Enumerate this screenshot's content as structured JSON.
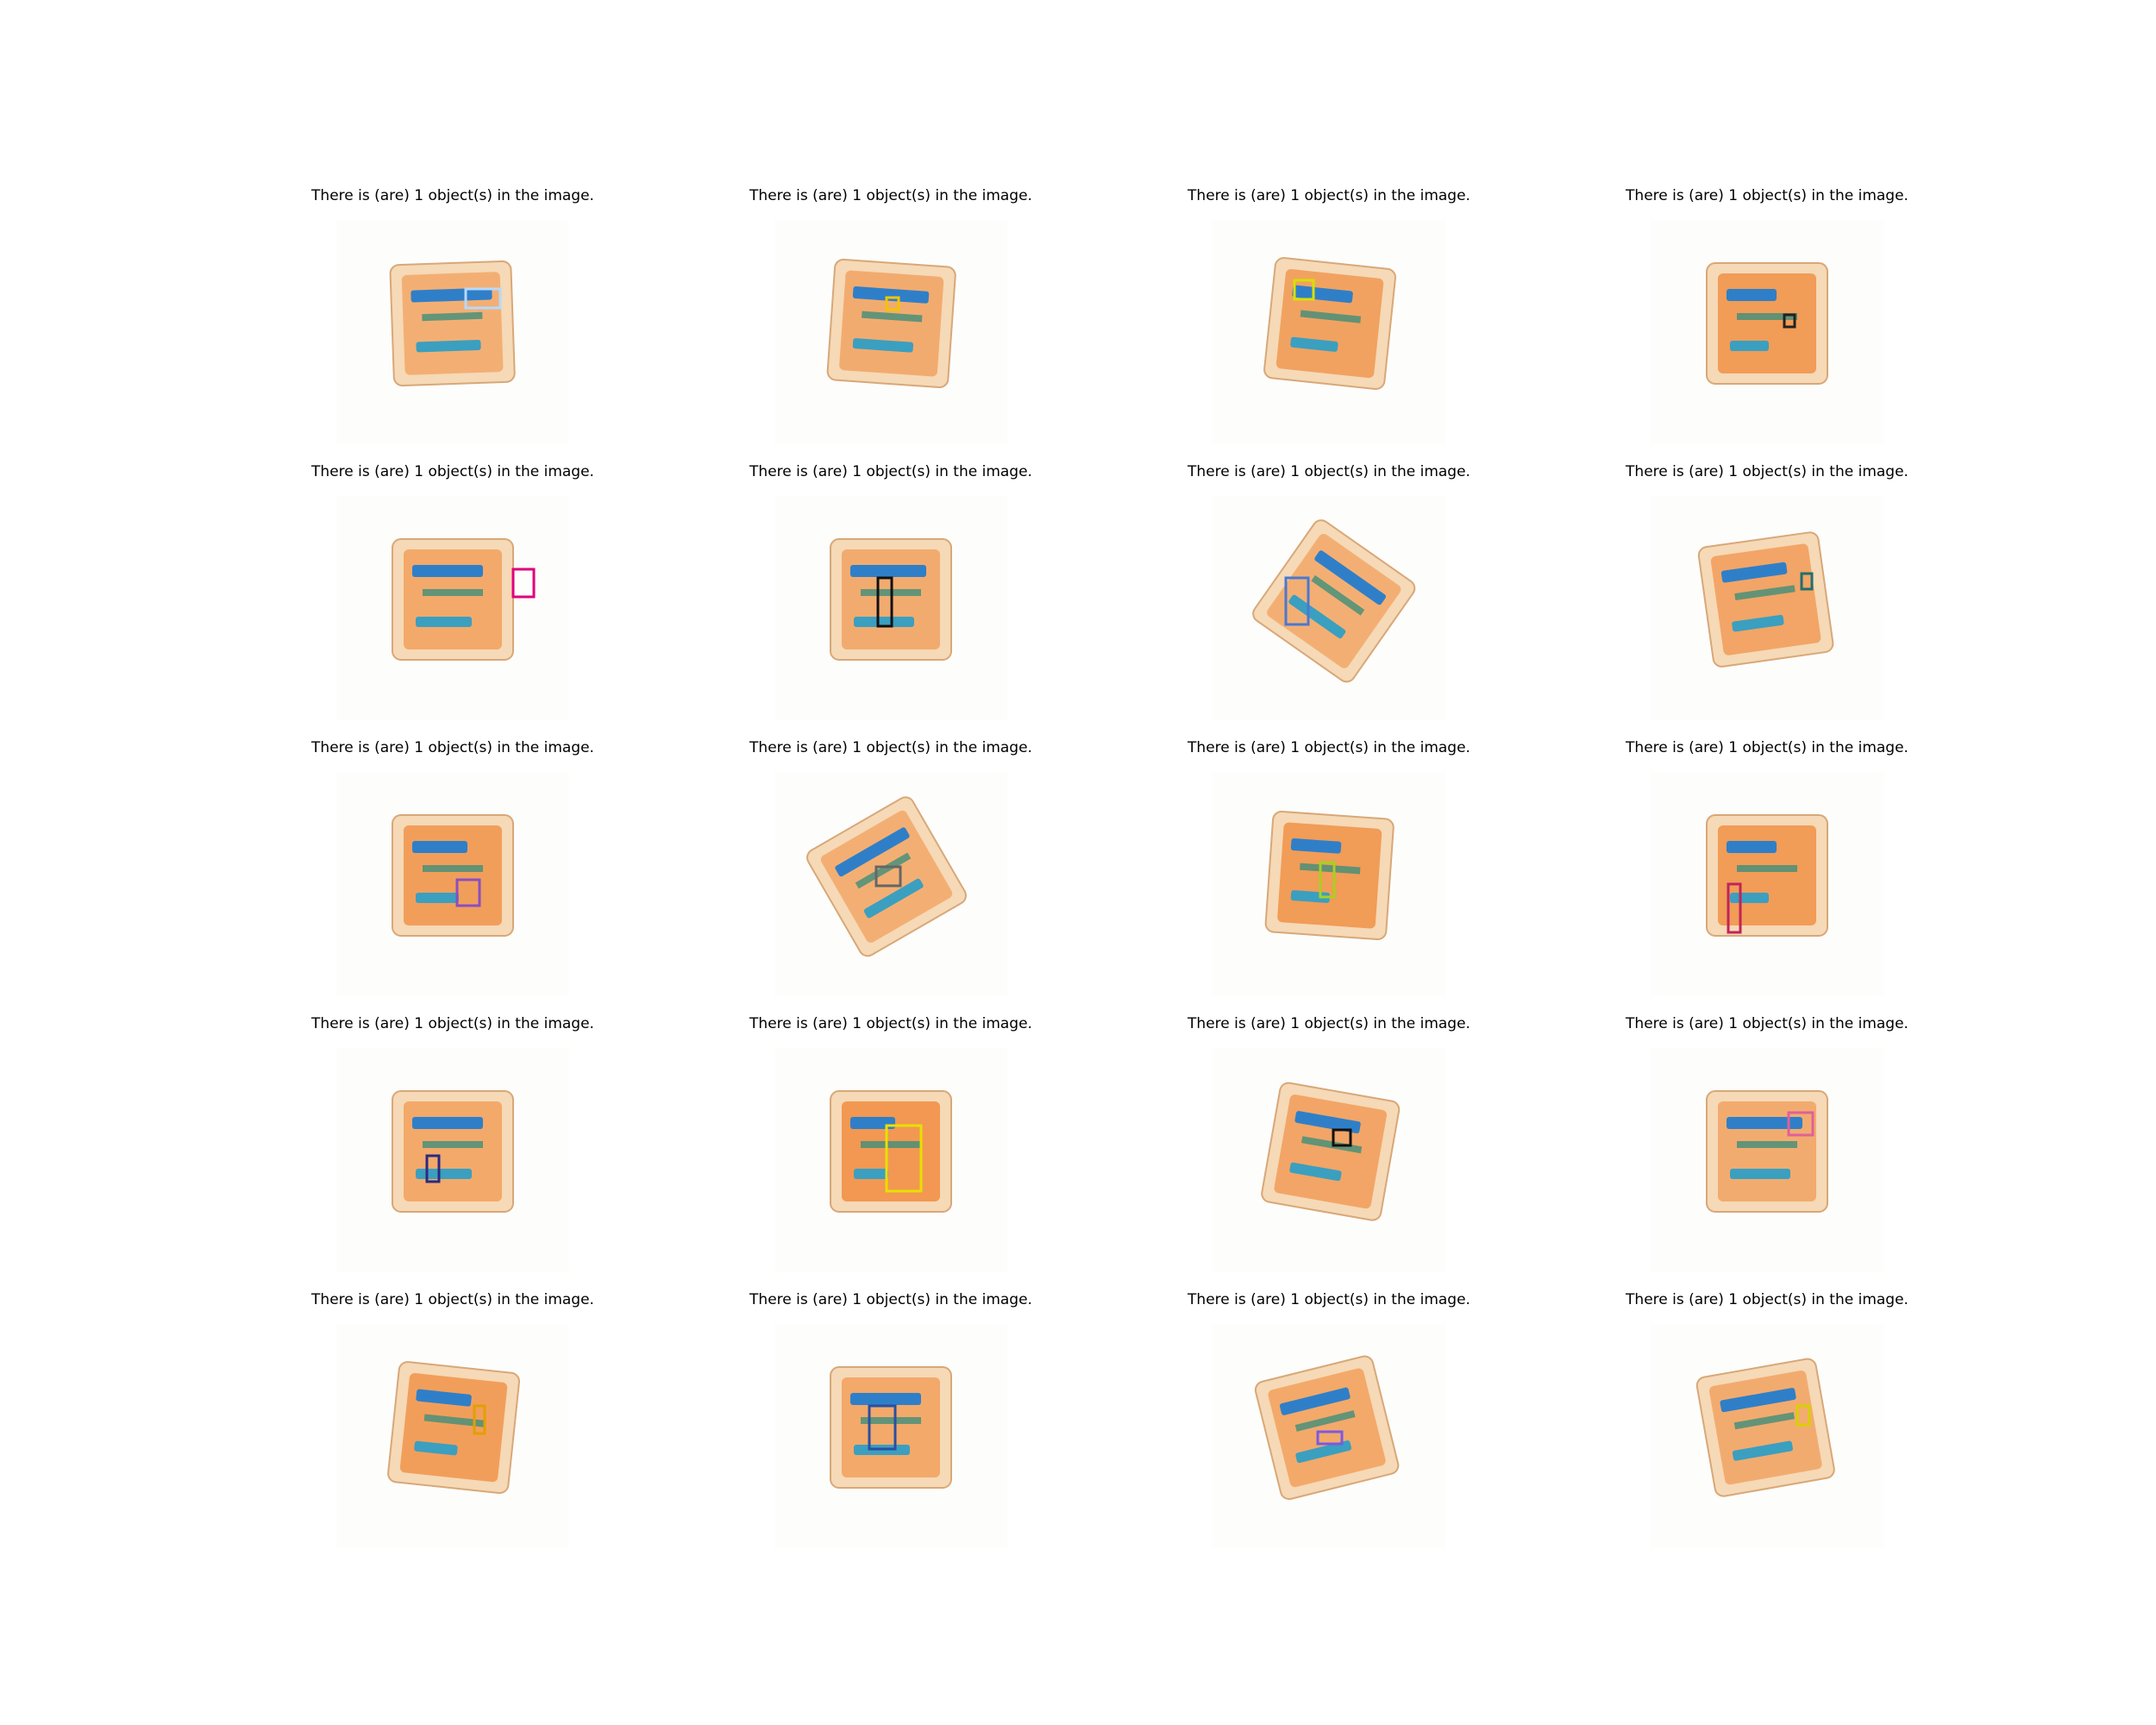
{
  "figure": {
    "panels": [
      {
        "caption": "There is (are) 1 object(s) in the image.",
        "box_color": "#b5d9ff"
      },
      {
        "caption": "There is (are) 1 object(s) in the image.",
        "box_color": "#f2c500"
      },
      {
        "caption": "There is (are) 1 object(s) in the image.",
        "box_color": "#d8e000"
      },
      {
        "caption": "There is (are) 1 object(s) in the image.",
        "box_color": "#222222"
      },
      {
        "caption": "There is (are) 1 object(s) in the image.",
        "box_color": "#e0007a"
      },
      {
        "caption": "There is (are) 1 object(s) in the image.",
        "box_color": "#111111"
      },
      {
        "caption": "There is (are) 1 object(s) in the image.",
        "box_color": "#4a78d0"
      },
      {
        "caption": "There is (are) 1 object(s) in the image.",
        "box_color": "#1f6f6f"
      },
      {
        "caption": "There is (are) 1 object(s) in the image.",
        "box_color": "#8a4fbf"
      },
      {
        "caption": "There is (are) 1 object(s) in the image.",
        "box_color": "#666666"
      },
      {
        "caption": "There is (are) 1 object(s) in the image.",
        "box_color": "#a8d020"
      },
      {
        "caption": "There is (are) 1 object(s) in the image.",
        "box_color": "#c0245a"
      },
      {
        "caption": "There is (are) 1 object(s) in the image.",
        "box_color": "#2a2a80"
      },
      {
        "caption": "There is (are) 1 object(s) in the image.",
        "box_color": "#e8e000"
      },
      {
        "caption": "There is (are) 1 object(s) in the image.",
        "box_color": "#111111"
      },
      {
        "caption": "There is (are) 1 object(s) in the image.",
        "box_color": "#e0609a"
      },
      {
        "caption": "There is (are) 1 object(s) in the image.",
        "box_color": "#e0a000"
      },
      {
        "caption": "There is (are) 1 object(s) in the image.",
        "box_color": "#2a4fa0"
      },
      {
        "caption": "There is (are) 1 object(s) in the image.",
        "box_color": "#7a5ae0"
      },
      {
        "caption": "There is (are) 1 object(s) in the image.",
        "box_color": "#d8d000"
      }
    ]
  }
}
